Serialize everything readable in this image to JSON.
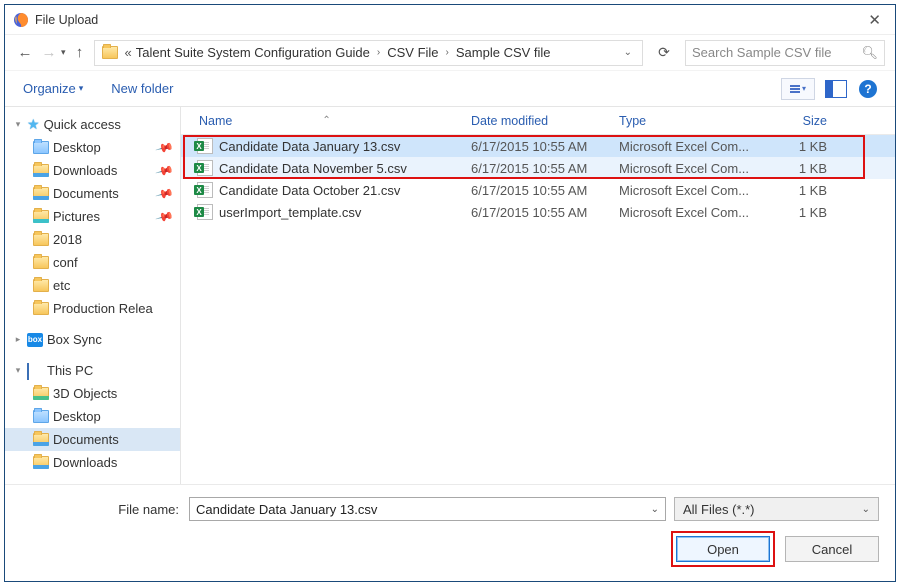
{
  "title": "File Upload",
  "nav": {
    "pre": "«",
    "crumbs": [
      "Talent Suite System Configuration Guide",
      "CSV File",
      "Sample CSV file"
    ]
  },
  "search": {
    "placeholder": "Search Sample CSV file"
  },
  "toolbar": {
    "organize": "Organize",
    "newfolder": "New folder"
  },
  "columns": {
    "name": "Name",
    "date": "Date modified",
    "type": "Type",
    "size": "Size"
  },
  "sidebar": {
    "quick": "Quick access",
    "desktop": "Desktop",
    "downloads": "Downloads",
    "documents": "Documents",
    "pictures": "Pictures",
    "y2018": "2018",
    "conf": "conf",
    "etc": "etc",
    "prod": "Production Relea",
    "box": "Box Sync",
    "thispc": "This PC",
    "obj3d": "3D Objects",
    "desktop2": "Desktop",
    "documents2": "Documents",
    "downloads2": "Downloads"
  },
  "files": [
    {
      "name": "Candidate Data January 13.csv",
      "date": "6/17/2015 10:55 AM",
      "type": "Microsoft Excel Com...",
      "size": "1 KB"
    },
    {
      "name": "Candidate Data November 5.csv",
      "date": "6/17/2015 10:55 AM",
      "type": "Microsoft Excel Com...",
      "size": "1 KB"
    },
    {
      "name": "Candidate Data October 21.csv",
      "date": "6/17/2015 10:55 AM",
      "type": "Microsoft Excel Com...",
      "size": "1 KB"
    },
    {
      "name": "userImport_template.csv",
      "date": "6/17/2015 10:55 AM",
      "type": "Microsoft Excel Com...",
      "size": "1 KB"
    }
  ],
  "filename": {
    "label": "File name:",
    "value": "Candidate Data January 13.csv"
  },
  "filter": "All Files (*.*)",
  "buttons": {
    "open": "Open",
    "cancel": "Cancel"
  }
}
